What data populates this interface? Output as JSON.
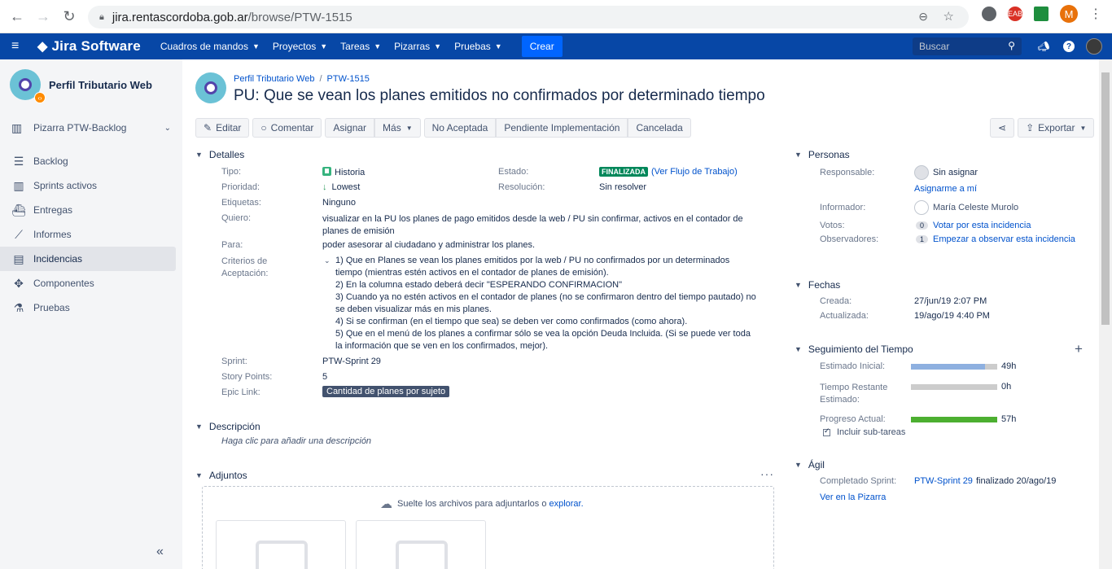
{
  "browser": {
    "url_host": "jira.rentascordoba.gob.ar",
    "url_path": "/browse/PTW-1515",
    "profile_initial": "M",
    "ext_badge": "EAB"
  },
  "topnav": {
    "app_name": "Jira Software",
    "menu": [
      "Cuadros de mandos",
      "Proyectos",
      "Tareas",
      "Pizarras",
      "Pruebas"
    ],
    "create_label": "Crear",
    "search_placeholder": "Buscar"
  },
  "sidebar": {
    "project_name": "Perfil Tributario Web",
    "board": "Pizarra PTW-Backlog",
    "items": [
      {
        "label": "Backlog",
        "icon": "backlog-icon"
      },
      {
        "label": "Sprints activos",
        "icon": "sprints-icon"
      },
      {
        "label": "Entregas",
        "icon": "ship-icon"
      },
      {
        "label": "Informes",
        "icon": "chart-icon"
      },
      {
        "label": "Incidencias",
        "icon": "issues-icon",
        "active": true
      },
      {
        "label": "Componentes",
        "icon": "puzzle-icon"
      },
      {
        "label": "Pruebas",
        "icon": "beaker-icon"
      }
    ],
    "collapse_label": "«"
  },
  "issue": {
    "breadcrumb_project": "Perfil Tributario Web",
    "breadcrumb_key": "PTW-1515",
    "title": "PU: Que se vean los planes emitidos no confirmados por determinado tiempo"
  },
  "toolbar": {
    "edit": "Editar",
    "comment": "Comentar",
    "assign": "Asignar",
    "more": "Más",
    "not_accepted": "No Aceptada",
    "pending": "Pendiente Implementación",
    "cancelled": "Cancelada",
    "export": "Exportar"
  },
  "details": {
    "section": "Detalles",
    "type_label": "Tipo:",
    "type_value": "Historia",
    "priority_label": "Prioridad:",
    "priority_value": "Lowest",
    "labels_label": "Etiquetas:",
    "labels_value": "Ninguno",
    "want_label": "Quiero:",
    "want_value": "visualizar en la PU los planes de pago emitidos desde la web / PU sin confirmar, activos en el contador de planes de emisión",
    "for_label": "Para:",
    "for_value": "poder asesorar al ciudadano y administrar los planes.",
    "criteria_label_1": "Criterios de",
    "criteria_label_2": "Aceptación:",
    "criteria": [
      "1) Que en Planes se vean los planes emitidos por la web / PU no confirmados por un determinados tiempo (mientras estén activos en el contador de planes de emisión).",
      "2) En la columna estado deberá decir \"ESPERANDO CONFIRMACION\"",
      "3) Cuando ya no estén activos en el contador de planes (no se confirmaron dentro del tiempo pautado) no se deben visualizar más en mis planes.",
      "4) Si se confirman (en el tiempo que sea) se deben ver como confirmados (como ahora).",
      "5) Que en el menú de los planes a confirmar sólo se vea la opción Deuda Incluida. (Si se puede ver toda la información que se ven en los confirmados, mejor)."
    ],
    "sprint_label": "Sprint:",
    "sprint_value": "PTW-Sprint 29",
    "points_label": "Story Points:",
    "points_value": "5",
    "epic_label": "Epic Link:",
    "epic_value": "Cantidad de planes por sujeto",
    "status_label": "Estado:",
    "status_value": "FINALIZADA",
    "workflow_link": "(Ver Flujo de Trabajo)",
    "resolution_label": "Resolución:",
    "resolution_value": "Sin resolver"
  },
  "description": {
    "section": "Descripción",
    "placeholder": "Haga clic para añadir una descripción"
  },
  "attachments": {
    "section": "Adjuntos",
    "drop_text": "Suelte los archivos para adjuntarlos o",
    "browse_link": "explorar.",
    "more": "···"
  },
  "people": {
    "section": "Personas",
    "assignee_label": "Responsable:",
    "assignee_value": "Sin asignar",
    "assign_me": "Asignarme a mí",
    "reporter_label": "Informador:",
    "reporter_value": "María Celeste Murolo",
    "votes_label": "Votos:",
    "votes_count": "0",
    "votes_link": "Votar por esta incidencia",
    "watchers_label": "Observadores:",
    "watchers_count": "1",
    "watchers_link": "Empezar a observar esta incidencia"
  },
  "dates": {
    "section": "Fechas",
    "created_label": "Creada:",
    "created_value": "27/jun/19 2:07 PM",
    "updated_label": "Actualizada:",
    "updated_value": "19/ago/19 4:40 PM"
  },
  "time_tracking": {
    "section": "Seguimiento del Tiempo",
    "estimated_label": "Estimado Inicial:",
    "estimated_value": "49h",
    "estimated_fraction": 0.86,
    "remaining_label_1": "Tiempo Restante",
    "remaining_label_2": "Estimado:",
    "remaining_value": "0h",
    "remaining_fraction": 0,
    "progress_label": "Progreso Actual:",
    "progress_value": "57h",
    "progress_fraction": 1,
    "include_subtasks": "Incluir sub-tareas",
    "add": "+"
  },
  "agile": {
    "section": "Ágil",
    "completed_label": "Completado Sprint:",
    "completed_sprint": "PTW-Sprint 29",
    "completed_suffix": "finalizado 20/ago/19",
    "board_link": "Ver en la Pizarra"
  },
  "colors": {
    "topnav": "#0747a6",
    "estimate_bar": "#8eb0e0",
    "progress_bar": "#4caf30",
    "status_green": "#00875a"
  }
}
